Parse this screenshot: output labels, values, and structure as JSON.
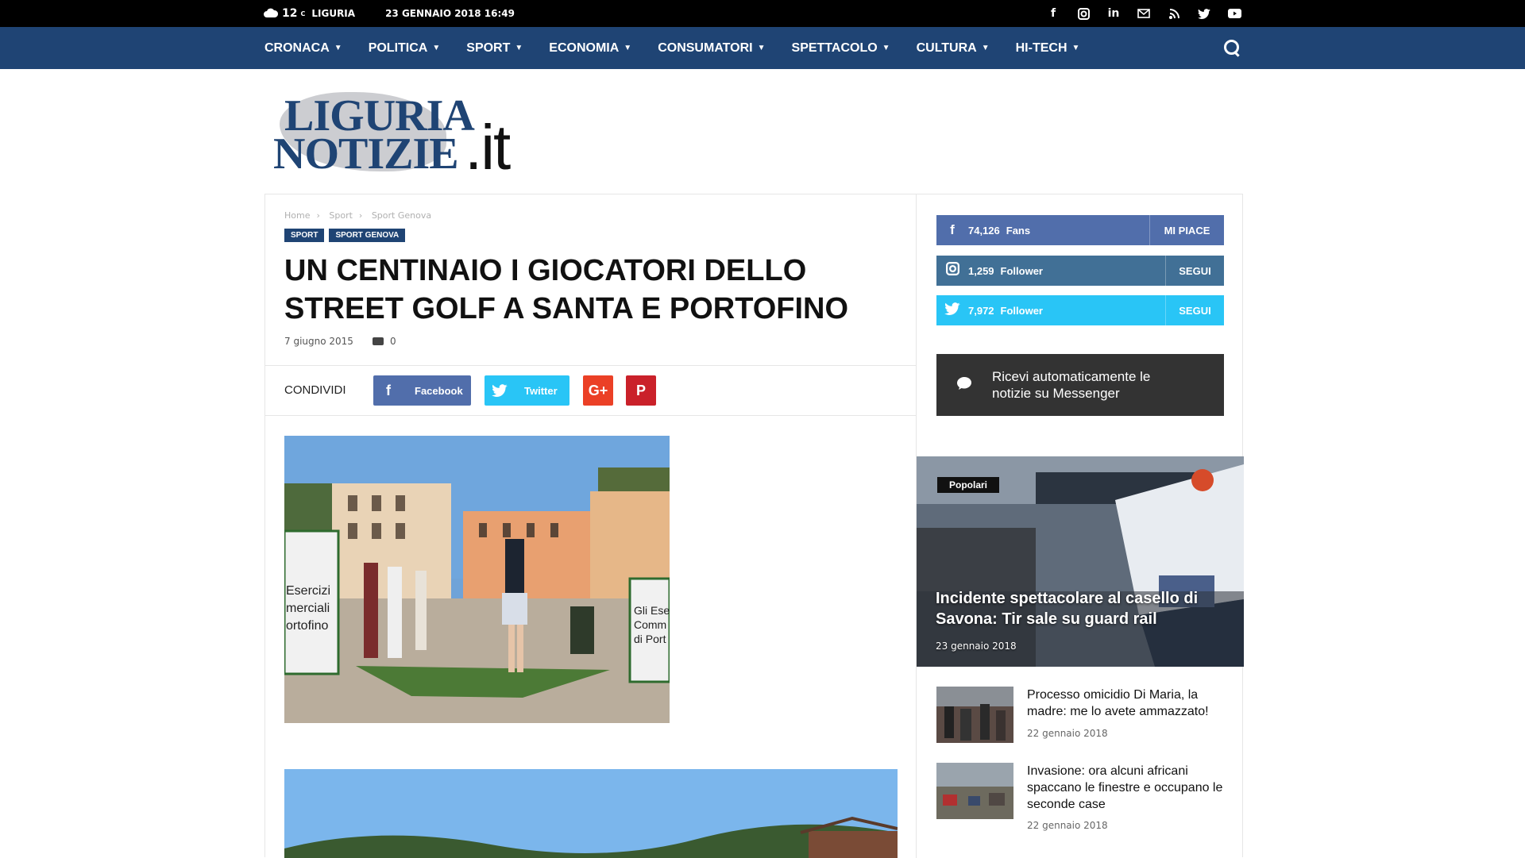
{
  "topbar": {
    "temp": "12",
    "unit": "C",
    "location": "LIGURIA",
    "date": "23 GENNAIO 2018 16:49",
    "social_icons": [
      "facebook-icon",
      "instagram-icon",
      "linkedin-icon",
      "mail-icon",
      "rss-icon",
      "twitter-icon",
      "youtube-icon"
    ]
  },
  "nav": {
    "items": [
      "CRONACA",
      "POLITICA",
      "SPORT",
      "ECONOMIA",
      "CONSUMATORI",
      "SPETTACOLO",
      "CULTURA",
      "HI-TECH"
    ]
  },
  "logo": {
    "line1": "LIGURIA",
    "line2": "NOTIZIE",
    "suffix": ".it"
  },
  "article": {
    "breadcrumb": [
      "Home",
      "Sport",
      "Sport Genova"
    ],
    "categories": [
      "SPORT",
      "SPORT GENOVA"
    ],
    "title": "UN CENTINAIO I GIOCATORI DELLO STREET GOLF A SANTA E PORTOFINO",
    "date": "7 giugno 2015",
    "comments": "0",
    "share_label": "CONDIVIDI",
    "share_facebook": "Facebook",
    "share_twitter": "Twitter",
    "sign1": "Esercizi\nmerciali\nortofino",
    "sign2": "Gli Ese\nComm\ndi Port"
  },
  "sidebar": {
    "facebook": {
      "count": "74,126",
      "unit": "Fans",
      "action": "MI PIACE"
    },
    "instagram": {
      "count": "1,259",
      "unit": "Follower",
      "action": "SEGUI"
    },
    "twitter": {
      "count": "7,972",
      "unit": "Follower",
      "action": "SEGUI"
    },
    "messenger": "Ricevi automaticamente le notizie su Messenger",
    "popular": {
      "badge": "Popolari",
      "title": "Incidente spettacolare al casello di Savona: Tir sale su guard rail",
      "date": "23 gennaio 2018"
    },
    "posts": [
      {
        "title": "Processo omicidio Di Maria, la madre: me lo avete ammazzato!",
        "date": "22 gennaio 2018"
      },
      {
        "title": "Invasione: ora alcuni africani spaccano le finestre e occupano le seconde case",
        "date": "22 gennaio 2018"
      }
    ]
  },
  "colors": {
    "nav": "#1f4474",
    "facebook": "#516eab",
    "instagram": "#417096",
    "twitter": "#29c5f6",
    "googleplus": "#eb4026",
    "pinterest": "#ca212a"
  }
}
